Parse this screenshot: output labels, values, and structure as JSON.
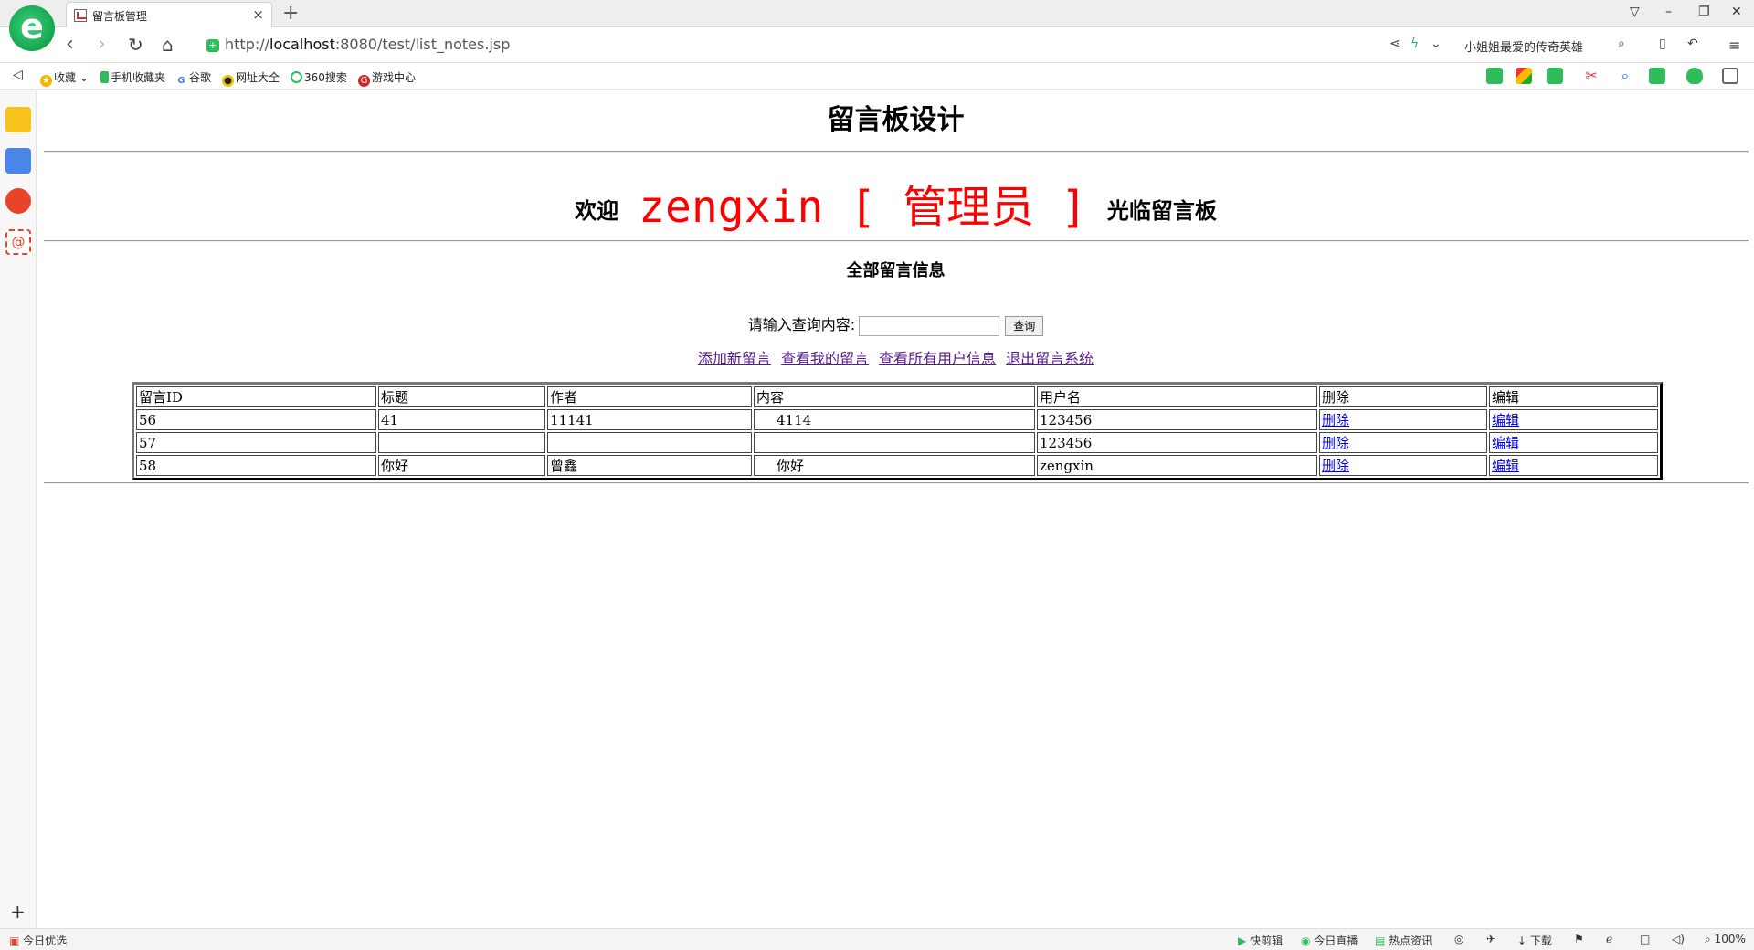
{
  "browser": {
    "tab_title": "留言板管理",
    "tab_close": "×",
    "new_tab": "+",
    "url_prefix": "http://",
    "url_host": "localhost",
    "url_rest": ":8080/test/list_notes.jsp",
    "search_text": "小姐姐最爱的传奇英雄",
    "zoom": "100%"
  },
  "bookmarks": [
    {
      "label": "收藏"
    },
    {
      "label": "手机收藏夹"
    },
    {
      "label": "谷歌"
    },
    {
      "label": "网址大全"
    },
    {
      "label": "360搜索"
    },
    {
      "label": "游戏中心"
    }
  ],
  "statusbar": {
    "left": "今日优选",
    "items": [
      "快剪辑",
      "今日直播",
      "热点资讯",
      "下载"
    ]
  },
  "page": {
    "title": "留言板设计",
    "welcome_prefix": "欢迎",
    "welcome_user": "zengxin [ 管理员 ]",
    "welcome_suffix": "光临留言板",
    "section_title": "全部留言信息",
    "query_label": "请输入查询内容:",
    "query_value": "",
    "query_button": "查询",
    "links": [
      "添加新留言",
      "查看我的留言",
      "查看所有用户信息",
      "退出留言系统"
    ]
  },
  "table": {
    "headers": [
      "留言ID",
      "标题",
      "作者",
      "内容",
      "用户名",
      "删除",
      "编辑"
    ],
    "rows": [
      {
        "id": "56",
        "title": "41",
        "author": "11141",
        "content": "4114",
        "username": "123456",
        "delete": "删除",
        "edit": "编辑"
      },
      {
        "id": "57",
        "title": "",
        "author": "",
        "content": "",
        "username": "123456",
        "delete": "删除",
        "edit": "编辑"
      },
      {
        "id": "58",
        "title": "你好",
        "author": "曾鑫",
        "content": "你好",
        "username": "zengxin",
        "delete": "删除",
        "edit": "编辑"
      }
    ]
  },
  "colors": {
    "accent_red": "#ff0000",
    "link_visited": "#551a8b",
    "link": "#0000ee"
  }
}
